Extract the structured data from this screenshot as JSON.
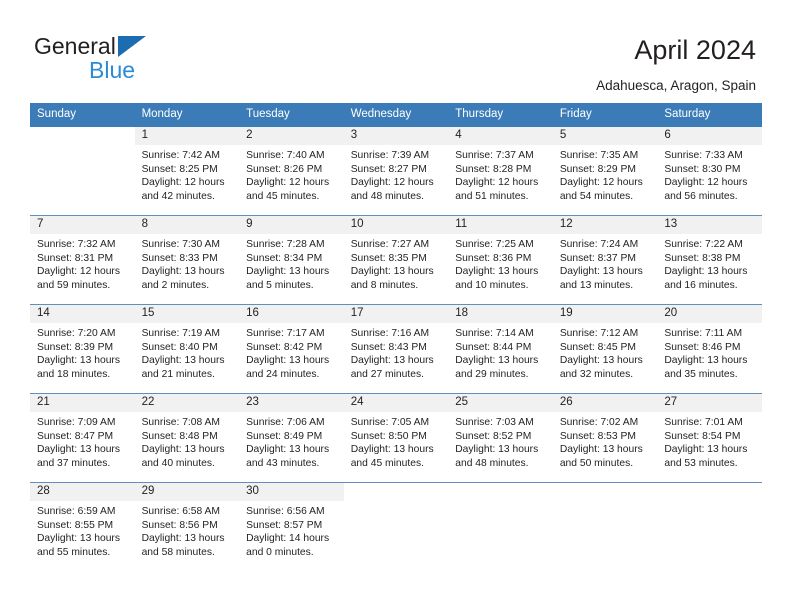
{
  "brand": {
    "name_part1": "General",
    "name_part2": "Blue",
    "triangle_color": "#1b6cb0",
    "blue_color": "#2b8bd4"
  },
  "header": {
    "title": "April 2024",
    "subtitle": "Adahuesca, Aragon, Spain"
  },
  "calendar": {
    "header_bg": "#3b7cb8",
    "header_fg": "#ffffff",
    "daynum_bg": "#f1f1f1",
    "row_line": "#5f8fc0",
    "weekdays": [
      "Sunday",
      "Monday",
      "Tuesday",
      "Wednesday",
      "Thursday",
      "Friday",
      "Saturday"
    ],
    "weeks": [
      [
        {
          "day": "",
          "lines": []
        },
        {
          "day": "1",
          "lines": [
            "Sunrise: 7:42 AM",
            "Sunset: 8:25 PM",
            "Daylight: 12 hours",
            "and 42 minutes."
          ]
        },
        {
          "day": "2",
          "lines": [
            "Sunrise: 7:40 AM",
            "Sunset: 8:26 PM",
            "Daylight: 12 hours",
            "and 45 minutes."
          ]
        },
        {
          "day": "3",
          "lines": [
            "Sunrise: 7:39 AM",
            "Sunset: 8:27 PM",
            "Daylight: 12 hours",
            "and 48 minutes."
          ]
        },
        {
          "day": "4",
          "lines": [
            "Sunrise: 7:37 AM",
            "Sunset: 8:28 PM",
            "Daylight: 12 hours",
            "and 51 minutes."
          ]
        },
        {
          "day": "5",
          "lines": [
            "Sunrise: 7:35 AM",
            "Sunset: 8:29 PM",
            "Daylight: 12 hours",
            "and 54 minutes."
          ]
        },
        {
          "day": "6",
          "lines": [
            "Sunrise: 7:33 AM",
            "Sunset: 8:30 PM",
            "Daylight: 12 hours",
            "and 56 minutes."
          ]
        }
      ],
      [
        {
          "day": "7",
          "lines": [
            "Sunrise: 7:32 AM",
            "Sunset: 8:31 PM",
            "Daylight: 12 hours",
            "and 59 minutes."
          ]
        },
        {
          "day": "8",
          "lines": [
            "Sunrise: 7:30 AM",
            "Sunset: 8:33 PM",
            "Daylight: 13 hours",
            "and 2 minutes."
          ]
        },
        {
          "day": "9",
          "lines": [
            "Sunrise: 7:28 AM",
            "Sunset: 8:34 PM",
            "Daylight: 13 hours",
            "and 5 minutes."
          ]
        },
        {
          "day": "10",
          "lines": [
            "Sunrise: 7:27 AM",
            "Sunset: 8:35 PM",
            "Daylight: 13 hours",
            "and 8 minutes."
          ]
        },
        {
          "day": "11",
          "lines": [
            "Sunrise: 7:25 AM",
            "Sunset: 8:36 PM",
            "Daylight: 13 hours",
            "and 10 minutes."
          ]
        },
        {
          "day": "12",
          "lines": [
            "Sunrise: 7:24 AM",
            "Sunset: 8:37 PM",
            "Daylight: 13 hours",
            "and 13 minutes."
          ]
        },
        {
          "day": "13",
          "lines": [
            "Sunrise: 7:22 AM",
            "Sunset: 8:38 PM",
            "Daylight: 13 hours",
            "and 16 minutes."
          ]
        }
      ],
      [
        {
          "day": "14",
          "lines": [
            "Sunrise: 7:20 AM",
            "Sunset: 8:39 PM",
            "Daylight: 13 hours",
            "and 18 minutes."
          ]
        },
        {
          "day": "15",
          "lines": [
            "Sunrise: 7:19 AM",
            "Sunset: 8:40 PM",
            "Daylight: 13 hours",
            "and 21 minutes."
          ]
        },
        {
          "day": "16",
          "lines": [
            "Sunrise: 7:17 AM",
            "Sunset: 8:42 PM",
            "Daylight: 13 hours",
            "and 24 minutes."
          ]
        },
        {
          "day": "17",
          "lines": [
            "Sunrise: 7:16 AM",
            "Sunset: 8:43 PM",
            "Daylight: 13 hours",
            "and 27 minutes."
          ]
        },
        {
          "day": "18",
          "lines": [
            "Sunrise: 7:14 AM",
            "Sunset: 8:44 PM",
            "Daylight: 13 hours",
            "and 29 minutes."
          ]
        },
        {
          "day": "19",
          "lines": [
            "Sunrise: 7:12 AM",
            "Sunset: 8:45 PM",
            "Daylight: 13 hours",
            "and 32 minutes."
          ]
        },
        {
          "day": "20",
          "lines": [
            "Sunrise: 7:11 AM",
            "Sunset: 8:46 PM",
            "Daylight: 13 hours",
            "and 35 minutes."
          ]
        }
      ],
      [
        {
          "day": "21",
          "lines": [
            "Sunrise: 7:09 AM",
            "Sunset: 8:47 PM",
            "Daylight: 13 hours",
            "and 37 minutes."
          ]
        },
        {
          "day": "22",
          "lines": [
            "Sunrise: 7:08 AM",
            "Sunset: 8:48 PM",
            "Daylight: 13 hours",
            "and 40 minutes."
          ]
        },
        {
          "day": "23",
          "lines": [
            "Sunrise: 7:06 AM",
            "Sunset: 8:49 PM",
            "Daylight: 13 hours",
            "and 43 minutes."
          ]
        },
        {
          "day": "24",
          "lines": [
            "Sunrise: 7:05 AM",
            "Sunset: 8:50 PM",
            "Daylight: 13 hours",
            "and 45 minutes."
          ]
        },
        {
          "day": "25",
          "lines": [
            "Sunrise: 7:03 AM",
            "Sunset: 8:52 PM",
            "Daylight: 13 hours",
            "and 48 minutes."
          ]
        },
        {
          "day": "26",
          "lines": [
            "Sunrise: 7:02 AM",
            "Sunset: 8:53 PM",
            "Daylight: 13 hours",
            "and 50 minutes."
          ]
        },
        {
          "day": "27",
          "lines": [
            "Sunrise: 7:01 AM",
            "Sunset: 8:54 PM",
            "Daylight: 13 hours",
            "and 53 minutes."
          ]
        }
      ],
      [
        {
          "day": "28",
          "lines": [
            "Sunrise: 6:59 AM",
            "Sunset: 8:55 PM",
            "Daylight: 13 hours",
            "and 55 minutes."
          ]
        },
        {
          "day": "29",
          "lines": [
            "Sunrise: 6:58 AM",
            "Sunset: 8:56 PM",
            "Daylight: 13 hours",
            "and 58 minutes."
          ]
        },
        {
          "day": "30",
          "lines": [
            "Sunrise: 6:56 AM",
            "Sunset: 8:57 PM",
            "Daylight: 14 hours",
            "and 0 minutes."
          ]
        },
        {
          "day": "",
          "lines": []
        },
        {
          "day": "",
          "lines": []
        },
        {
          "day": "",
          "lines": []
        },
        {
          "day": "",
          "lines": []
        }
      ]
    ]
  }
}
